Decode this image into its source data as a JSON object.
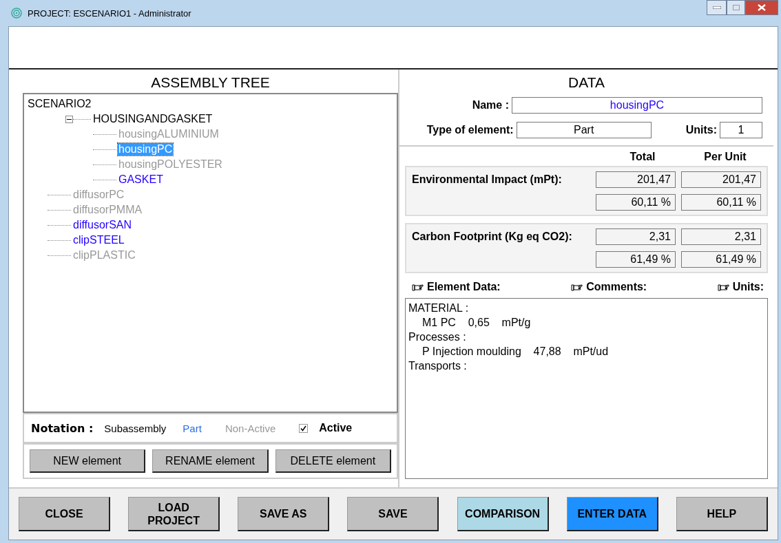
{
  "window": {
    "title": "PROJECT: ESCENARIO1 - Administrator"
  },
  "assembly_tree": {
    "heading": "ASSEMBLY TREE",
    "root": "SCENARIO2",
    "items": [
      {
        "label": "HOUSINGANDGASKET",
        "kind": "subassembly",
        "active": true,
        "selected": false,
        "expanded": true,
        "children": [
          {
            "label": "housingALUMINIUM",
            "kind": "part",
            "active": false,
            "selected": false
          },
          {
            "label": "housingPC",
            "kind": "part",
            "active": true,
            "selected": true
          },
          {
            "label": "housingPOLYESTER",
            "kind": "part",
            "active": false,
            "selected": false
          },
          {
            "label": "GASKET",
            "kind": "part",
            "active": true,
            "selected": false
          }
        ]
      },
      {
        "label": "diffusorPC",
        "kind": "part",
        "active": false,
        "selected": false
      },
      {
        "label": "diffusorPMMA",
        "kind": "part",
        "active": false,
        "selected": false
      },
      {
        "label": "diffusorSAN",
        "kind": "part",
        "active": true,
        "selected": false
      },
      {
        "label": "clipSTEEL",
        "kind": "part",
        "active": true,
        "selected": false
      },
      {
        "label": "clipPLASTIC",
        "kind": "part",
        "active": false,
        "selected": false
      }
    ]
  },
  "notation": {
    "label": "Notation :",
    "subassembly": "Subassembly",
    "part": "Part",
    "non_active": "Non-Active",
    "active_label": "Active",
    "active_checked": true
  },
  "tree_buttons": [
    "NEW element",
    "RENAME element",
    "DELETE element"
  ],
  "data": {
    "heading": "DATA",
    "name_label": "Name :",
    "name": "housingPC",
    "type_label": "Type of element:",
    "type": "Part",
    "units_label": "Units:",
    "units": "1",
    "col_total": "Total",
    "col_per_unit": "Per Unit",
    "metrics": [
      {
        "label": "Environmental Impact (mPt):",
        "total": "201,47",
        "per_unit": "201,47",
        "total_pct": "60,11 %",
        "per_unit_pct": "60,11 %"
      },
      {
        "label": "Carbon Footprint (Kg eq CO2):",
        "total": "2,31",
        "per_unit": "2,31",
        "total_pct": "61,49 %",
        "per_unit_pct": "61,49 %"
      }
    ],
    "tabs": [
      "Element Data:",
      "Comments:",
      "Units:"
    ],
    "element_data": [
      {
        "title": "MATERIAL :",
        "items": [
          "M1 PC    0,65    mPt/g"
        ]
      },
      {
        "title": "Processes :",
        "items": [
          "P Injection moulding    47,88    mPt/ud"
        ]
      },
      {
        "title": "Transports :"
      }
    ]
  },
  "buttons": [
    {
      "label": "CLOSE",
      "color": "#c0c0c0"
    },
    {
      "label": "LOAD\nPROJECT",
      "color": "#c0c0c0"
    },
    {
      "label": "SAVE AS",
      "color": "#c0c0c0"
    },
    {
      "label": "SAVE",
      "color": "#c0c0c0"
    },
    {
      "label": "COMPARISON",
      "color": "#add8e6"
    },
    {
      "label": "ENTER DATA",
      "color": "#1e90ff"
    },
    {
      "label": "HELP",
      "color": "#c0c0c0"
    }
  ]
}
